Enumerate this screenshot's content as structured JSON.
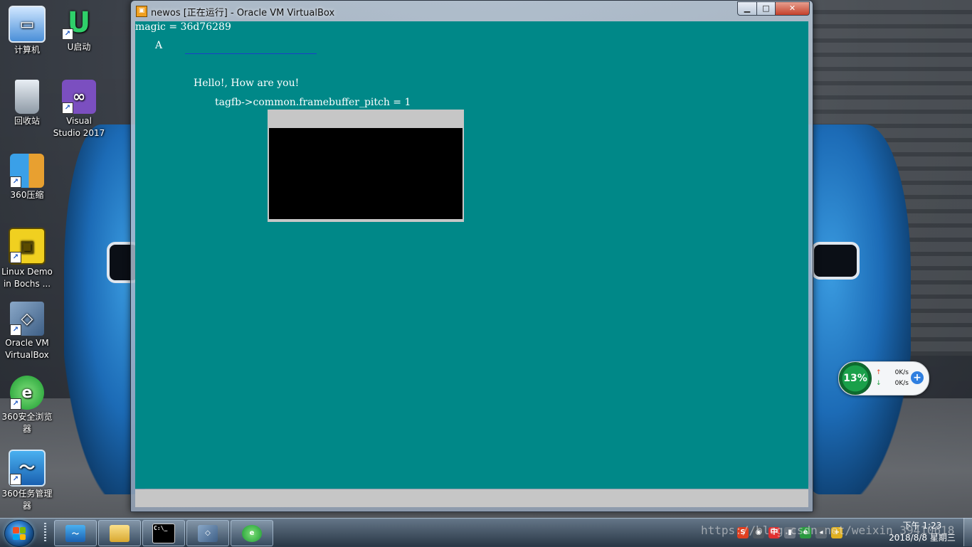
{
  "desktop": {
    "icons": [
      {
        "label": "计算机",
        "icon": "computer-icon"
      },
      {
        "label": "U启动",
        "icon": "u-startup-icon"
      },
      {
        "label": "回收站",
        "icon": "recycle-bin-icon"
      },
      {
        "label": "Visual Studio 2017",
        "icon": "visual-studio-icon"
      },
      {
        "label": "360压缩",
        "icon": "360-zip-icon"
      },
      {
        "label": "Linux Demo in Bochs ...",
        "icon": "bochs-icon"
      },
      {
        "label": "Oracle VM VirtualBox",
        "icon": "virtualbox-icon"
      },
      {
        "label": "360安全浏览器",
        "icon": "360-browser-icon"
      },
      {
        "label": "360任务管理器",
        "icon": "360-task-manager-icon"
      }
    ]
  },
  "vbox_window": {
    "title": "newos [正在运行] - Oracle VM VirtualBox",
    "minimize_label": "▁",
    "maximize_label": "□",
    "close_label": "✕"
  },
  "vm_screen": {
    "background_color": "#008888",
    "lines": {
      "magic": "magic = 36d76289",
      "letter": "A",
      "hello": "Hello!, How are you!",
      "pitch": "tagfb->common.framebuffer_pitch = 1"
    }
  },
  "net_widget": {
    "percent": "13%",
    "up_arrow": "↑",
    "down_arrow": "↓",
    "up_speed": "0K/s",
    "down_speed": "0K/s",
    "plus": "+"
  },
  "taskbar": {
    "buttons": [
      {
        "name": "360-task-manager",
        "icon": "360-task-manager-icon"
      },
      {
        "name": "file-explorer",
        "icon": "folder-icon"
      },
      {
        "name": "command-prompt",
        "icon": "cmd-icon",
        "glyph": "C:\\_"
      },
      {
        "name": "virtualbox",
        "icon": "virtualbox-icon"
      },
      {
        "name": "360-browser",
        "icon": "360-browser-icon"
      }
    ],
    "watermark": "https://blog.csdn.net/weixin_39410618",
    "clock_time": "下午 1:23",
    "clock_date": "2018/8/8 星期三"
  }
}
